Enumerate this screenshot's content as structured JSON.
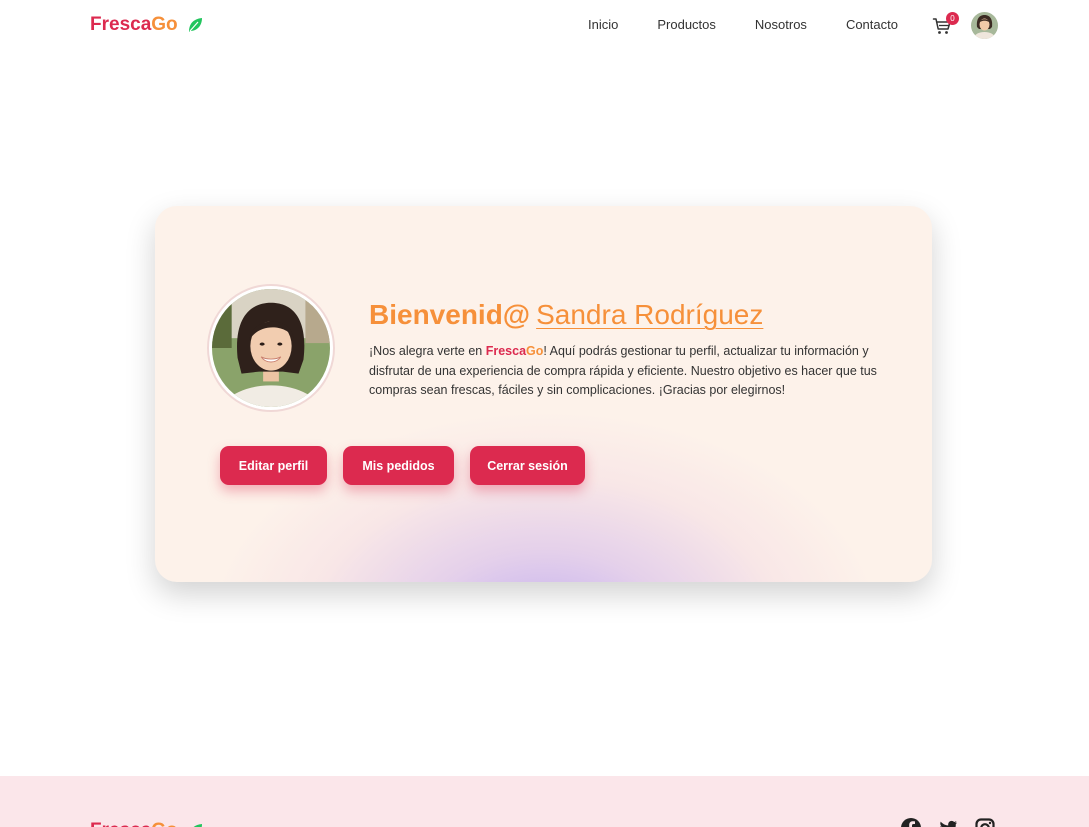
{
  "brand": {
    "part1": "Fresca",
    "part2": "Go",
    "icon": "leaf-icon"
  },
  "nav": {
    "items": [
      "Inicio",
      "Productos",
      "Nosotros",
      "Contacto"
    ]
  },
  "cart": {
    "icon": "cart-icon",
    "count": "0"
  },
  "profile": {
    "welcome_prefix": "Bienvenid@",
    "name": "Sandra Rodríguez",
    "desc_before": "¡Nos alegra verte en ",
    "desc_after": "! Aquí podrás gestionar tu perfil, actualizar tu información y disfrutar de una experiencia de compra rápida y eficiente. Nuestro objetivo es hacer que tus compras sean frescas, fáciles y sin complicaciones. ¡Gracias por elegirnos!"
  },
  "actions": {
    "edit": "Editar perfil",
    "orders": "Mis pedidos",
    "logout": "Cerrar sesión"
  },
  "footer": {
    "social": [
      "facebook-icon",
      "twitter-icon",
      "instagram-icon"
    ]
  },
  "colors": {
    "primary": "#dc2a4f",
    "accent": "#f6903a",
    "leaf": "#22c55e",
    "card_bg": "#fdf2ea",
    "footer_bg": "#fbe6ea"
  }
}
